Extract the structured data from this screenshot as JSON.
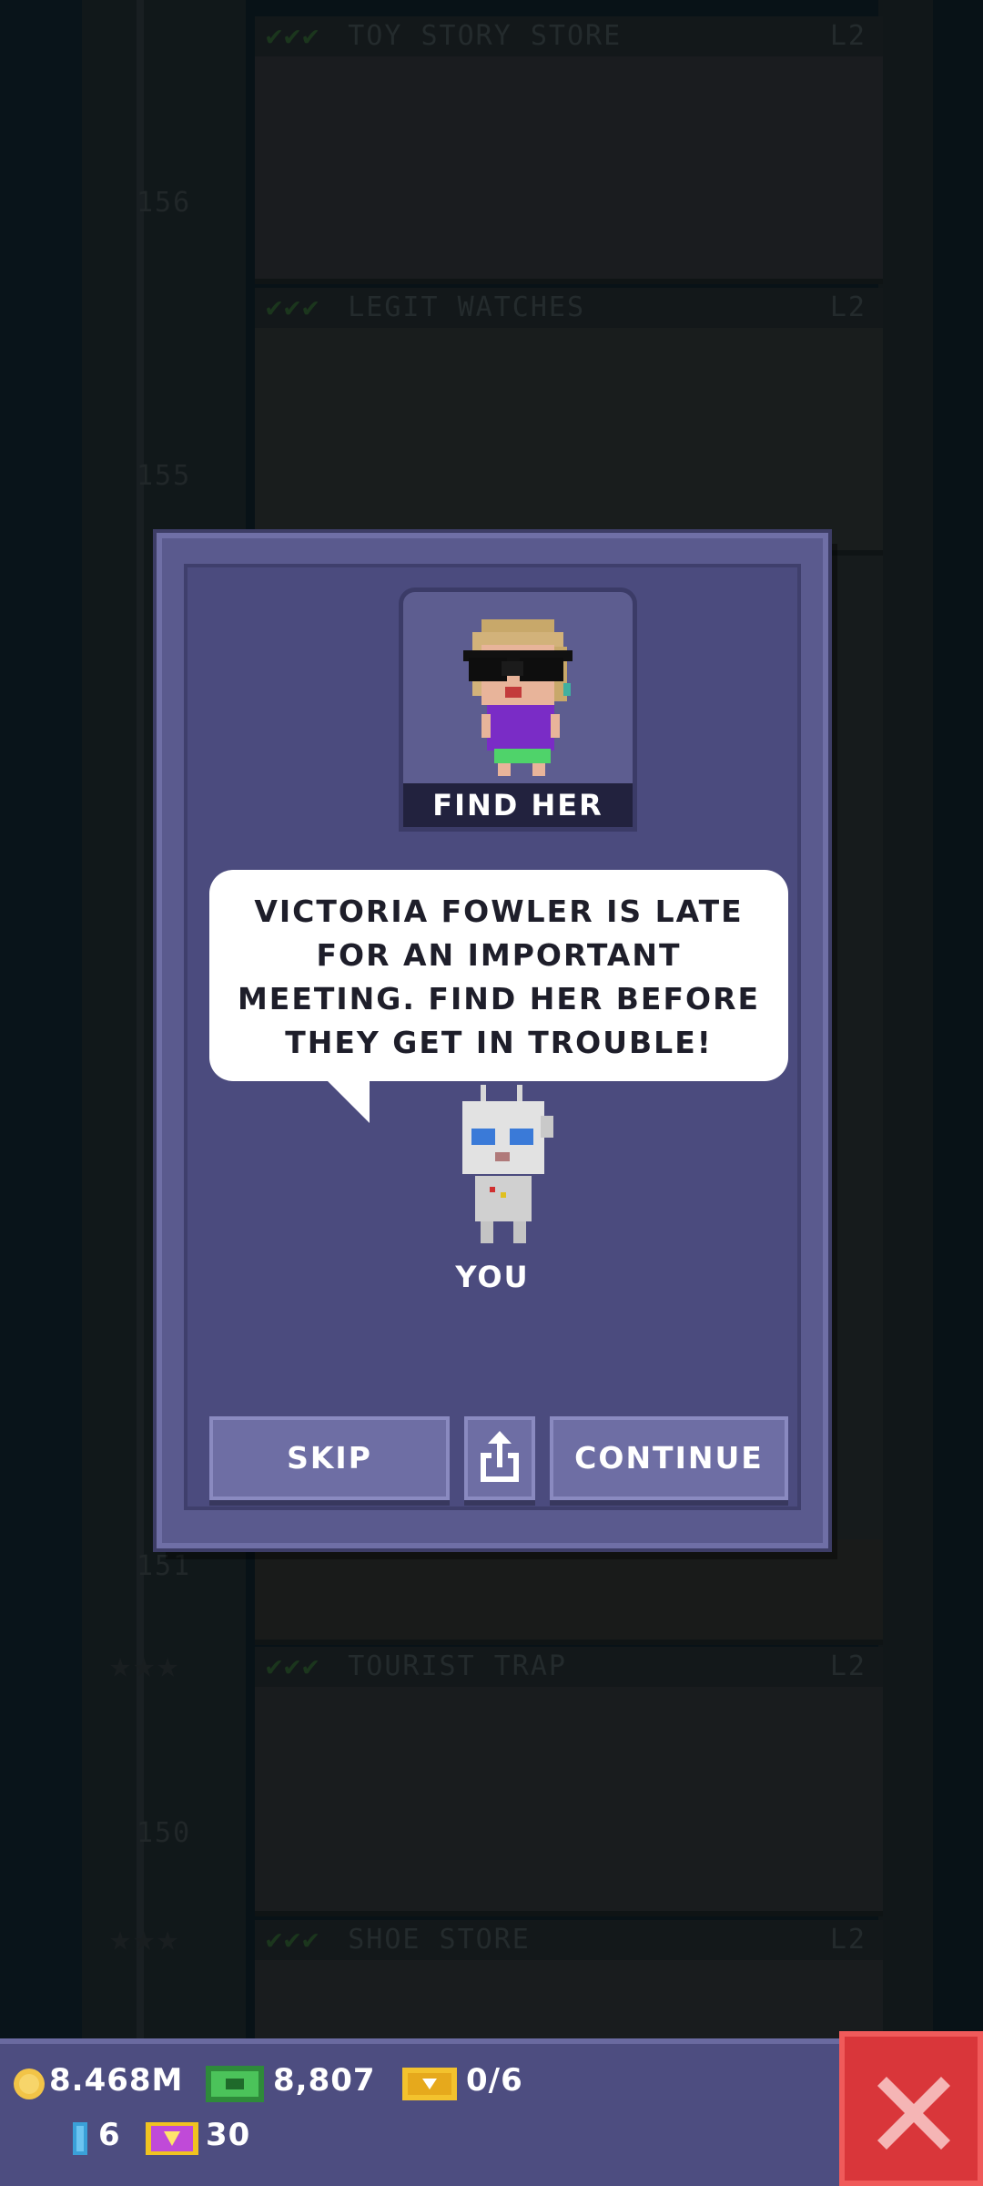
{
  "background_tower": {
    "floors": [
      {
        "name": "TOY STORY STORE",
        "level": "L2",
        "number": "156"
      },
      {
        "name": "LEGIT WATCHES",
        "level": "L2",
        "number": "155"
      },
      {
        "name": "",
        "level": "",
        "number": "151"
      },
      {
        "name": "TOURIST TRAP",
        "level": "L2",
        "number": "150"
      },
      {
        "name": "SHOE STORE",
        "level": "L2",
        "number": ""
      }
    ],
    "checks": "✔✔✔"
  },
  "dialog": {
    "portrait_label": "FIND HER",
    "message_lines": [
      "VICTORIA FOWLER IS LATE",
      "FOR AN IMPORTANT",
      "MEETING. FIND HER BEFORE",
      "THEY GET IN TROUBLE!"
    ],
    "speaker_label": "YOU",
    "skip_label": "SKIP",
    "continue_label": "CONTINUE",
    "share_icon": "share-icon"
  },
  "status_bar": {
    "coins": "8.468M",
    "bux": "8,807",
    "tickets": "0/6",
    "keys": "6",
    "gems": "30"
  },
  "colors": {
    "dialog_bg": "#4b4b7e",
    "close_button": "#d9363a",
    "status_bar": "#4d4d80"
  }
}
